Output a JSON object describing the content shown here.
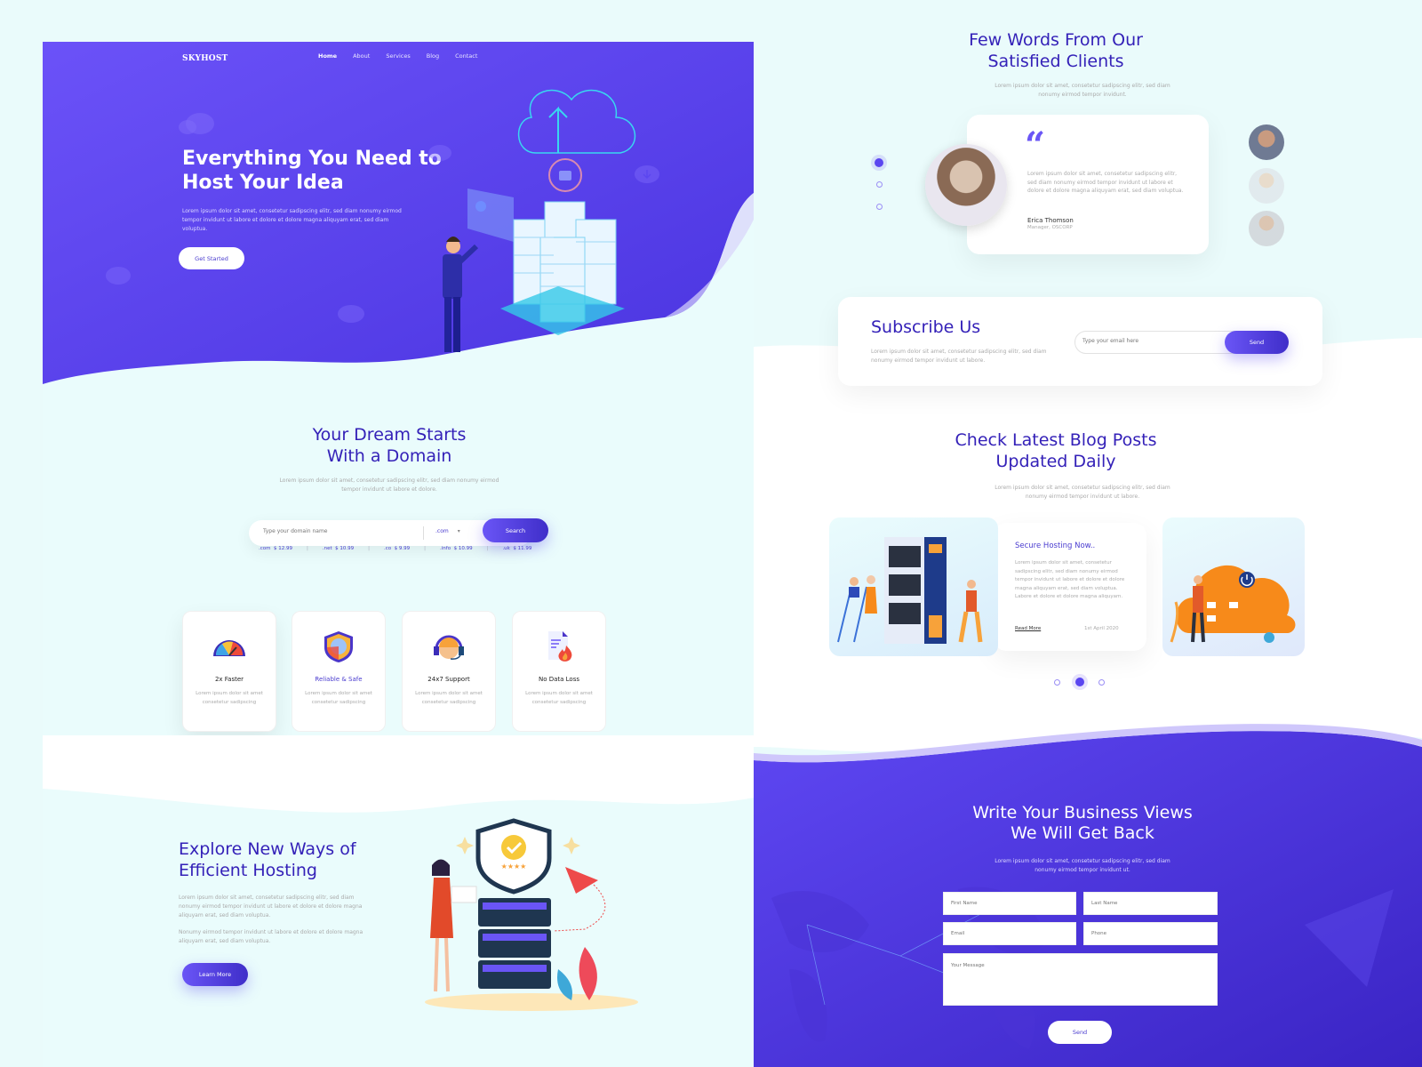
{
  "colors": {
    "primary": "#5b46f0",
    "primary_dark": "#3421b8",
    "background": "#eafbfb"
  },
  "nav": {
    "logo": "SKYHOST",
    "items": [
      {
        "label": "Home",
        "active": true
      },
      {
        "label": "About"
      },
      {
        "label": "Services"
      },
      {
        "label": "Blog"
      },
      {
        "label": "Contact"
      }
    ]
  },
  "hero": {
    "title_line1": "Everything You Need to",
    "title_line2": "Host Your Idea",
    "subtitle": "Lorem ipsum dolor sit amet, consetetur sadipscing elitr, sed diam nonumy eirmod tempor invidunt ut labore et dolore  et dolore magna aliquyam erat, sed diam voluptua.",
    "cta": "Get Started"
  },
  "domain": {
    "title_line1": "Your Dream Starts",
    "title_line2": "With a Domain",
    "subtitle": "Lorem ipsum dolor sit amet, consetetur sadipscing elitr, sed diam nonumy eirmod tempor invidunt ut labore et dolore.",
    "input_placeholder": "Type your domain name",
    "tld_selected": ".com",
    "search_label": "Search",
    "prices": [
      {
        "tld": ".com",
        "price": "$ 12.99"
      },
      {
        "tld": ".net",
        "price": "$ 10.99"
      },
      {
        "tld": ".co",
        "price": "$ 9.99"
      },
      {
        "tld": ".info",
        "price": "$ 10.99"
      },
      {
        "tld": ".uk",
        "price": "$ 11.99"
      }
    ]
  },
  "features": [
    {
      "title": "2x Faster",
      "desc": "Lorem ipsum dolor sit amet consetetur sadipscing",
      "icon": "speedometer-icon"
    },
    {
      "title": "Reliable & Safe",
      "desc": "Lorem ipsum dolor sit amet consetetur sadipscing",
      "icon": "shield-icon"
    },
    {
      "title": "24x7 Support",
      "desc": "Lorem ipsum dolor sit amet consetetur sadipscing",
      "icon": "headset-icon"
    },
    {
      "title": "No Data Loss",
      "desc": "Lorem ipsum dolor sit amet consetetur sadipscing",
      "icon": "document-fire-icon"
    }
  ],
  "explore": {
    "title_line1": "Explore New Ways of",
    "title_line2": "Efficient Hosting",
    "p1": "Lorem ipsum dolor sit amet, consetetur sadipscing elitr, sed diam nonumy eirmod tempor invidunt ut labore et dolore  et dolore magna aliquyam erat, sed diam voluptua.",
    "p2": "Nonumy eirmod tempor invidunt ut labore et dolore  et dolore magna aliquyam erat, sed diam voluptua.",
    "cta": "Learn More"
  },
  "testimonials": {
    "title_line1": "Few Words From Our",
    "title_line2": "Satisfied Clients",
    "subtitle": "Lorem ipsum dolor sit amet, consetetur sadipscing elitr, sed diam nonumy eirmod tempor invidunt.",
    "quote_mark": "“",
    "quote": "Lorem ipsum dolor sit amet, consetetur sadipscing elitr, sed diam nonumy eirmod tempor invidunt ut labore et dolore  et dolore magna aliquyam erat, sed diam voluptua.",
    "name": "Erica Thomson",
    "role": "Manager, OSCORP",
    "active_index": 0,
    "count": 3
  },
  "subscribe": {
    "title": "Subscribe Us",
    "subtitle": "Lorem ipsum dolor sit amet, consetetur sadipscing elitr, sed diam nonumy eirmod tempor invidunt ut labore.",
    "input_placeholder": "Type your email here",
    "button": "Send"
  },
  "blog": {
    "title_line1": "Check Latest Blog Posts",
    "title_line2": "Updated Daily",
    "subtitle": "Lorem ipsum dolor sit amet, consetetur sadipscing elitr, sed diam nonumy eirmod tempor invidunt ut labore.",
    "post_title": "Secure Hosting Now..",
    "post_excerpt": "Lorem ipsum dolor sit amet, consetetur sadipscing elitr, sed diam nonumy eirmod tempor invidunt ut labore et dolore  et dolore magna aliquyam erat, sed diam voluptua. Labore et dolore  et dolore magna aliquyam.",
    "read_more": "Read More",
    "date": "1st April 2020",
    "active_index": 1,
    "count": 3
  },
  "contact": {
    "title_line1": "Write Your Business Views",
    "title_line2": "We Will Get Back",
    "subtitle": "Lorem ipsum dolor sit amet, consetetur sadipscing elitr, sed diam nonumy eirmod tempor invidunt ut.",
    "first_name_placeholder": "First Name",
    "last_name_placeholder": "Last Name",
    "email_placeholder": "Email",
    "phone_placeholder": "Phone",
    "message_placeholder": "Your Message",
    "send": "Send"
  }
}
